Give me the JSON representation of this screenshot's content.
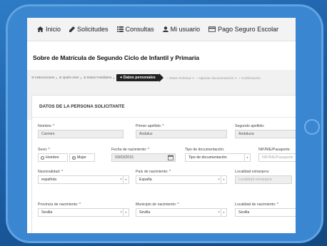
{
  "nav": {
    "items": [
      {
        "label": "Inicio",
        "icon": "home-icon"
      },
      {
        "label": "Solicitudes",
        "icon": "pencil-icon"
      },
      {
        "label": "Consultas",
        "icon": "list-icon"
      },
      {
        "label": "Mi usuario",
        "icon": "user-icon"
      },
      {
        "label": "Pago Seguro Escolar",
        "icon": "credit-card-icon"
      }
    ]
  },
  "page_title": "Sobre de Matrícula de Segundo Ciclo de Infantil y Primaria",
  "steps": {
    "items": [
      "Instrucciones",
      "Quién eres",
      "Datos Familiares"
    ],
    "active": "Datos personales",
    "after": [
      "Datos Solicitud",
      "Adjuntar documentación",
      "Confirmación"
    ]
  },
  "panel": {
    "title": "DATOS DE LA PERSONA SOLICITANTE"
  },
  "form": {
    "nombre": {
      "label": "Nombre: *",
      "value": "Carmen"
    },
    "primer_apellido": {
      "label": "Primer apellido: *",
      "value": "Andaluz"
    },
    "segundo_apellido": {
      "label": "Segundo apellido:",
      "value": "Andaluza"
    },
    "sexo": {
      "label": "Sexo: *",
      "options": [
        "Hombre",
        "Mujer"
      ],
      "selected": "Mujer"
    },
    "fecha_nacimiento": {
      "label": "Fecha de nacimiento: *",
      "value": "03/03/2015"
    },
    "tipo_documento": {
      "label": "Tipo de documentación:",
      "value": "Tipo de documentación"
    },
    "nif": {
      "label": "NIF/NIE/Pasaporte:",
      "placeholder": "NIF/NIE/Pasaporte"
    },
    "nacionalidad": {
      "label": "Nacionalidad: *",
      "value": "española"
    },
    "pais_nacimiento": {
      "label": "País de nacimiento: *",
      "value": "España"
    },
    "localidad_extranjera": {
      "label": "Localidad extranjera:",
      "placeholder": "Localidad extranjera"
    },
    "provincia_nacimiento": {
      "label": "Provincia de nacimiento: *",
      "value": "Sevilla"
    },
    "municipio_nacimiento": {
      "label": "Municipio de nacimiento: *",
      "value": "Sevilla"
    },
    "localidad_nacimiento": {
      "label": "Localidad de nacimiento: *",
      "value": "Sevilla"
    }
  },
  "colors": {
    "frame": "#3b86d1",
    "background": "#1f63a8",
    "active_step": "#222222"
  }
}
